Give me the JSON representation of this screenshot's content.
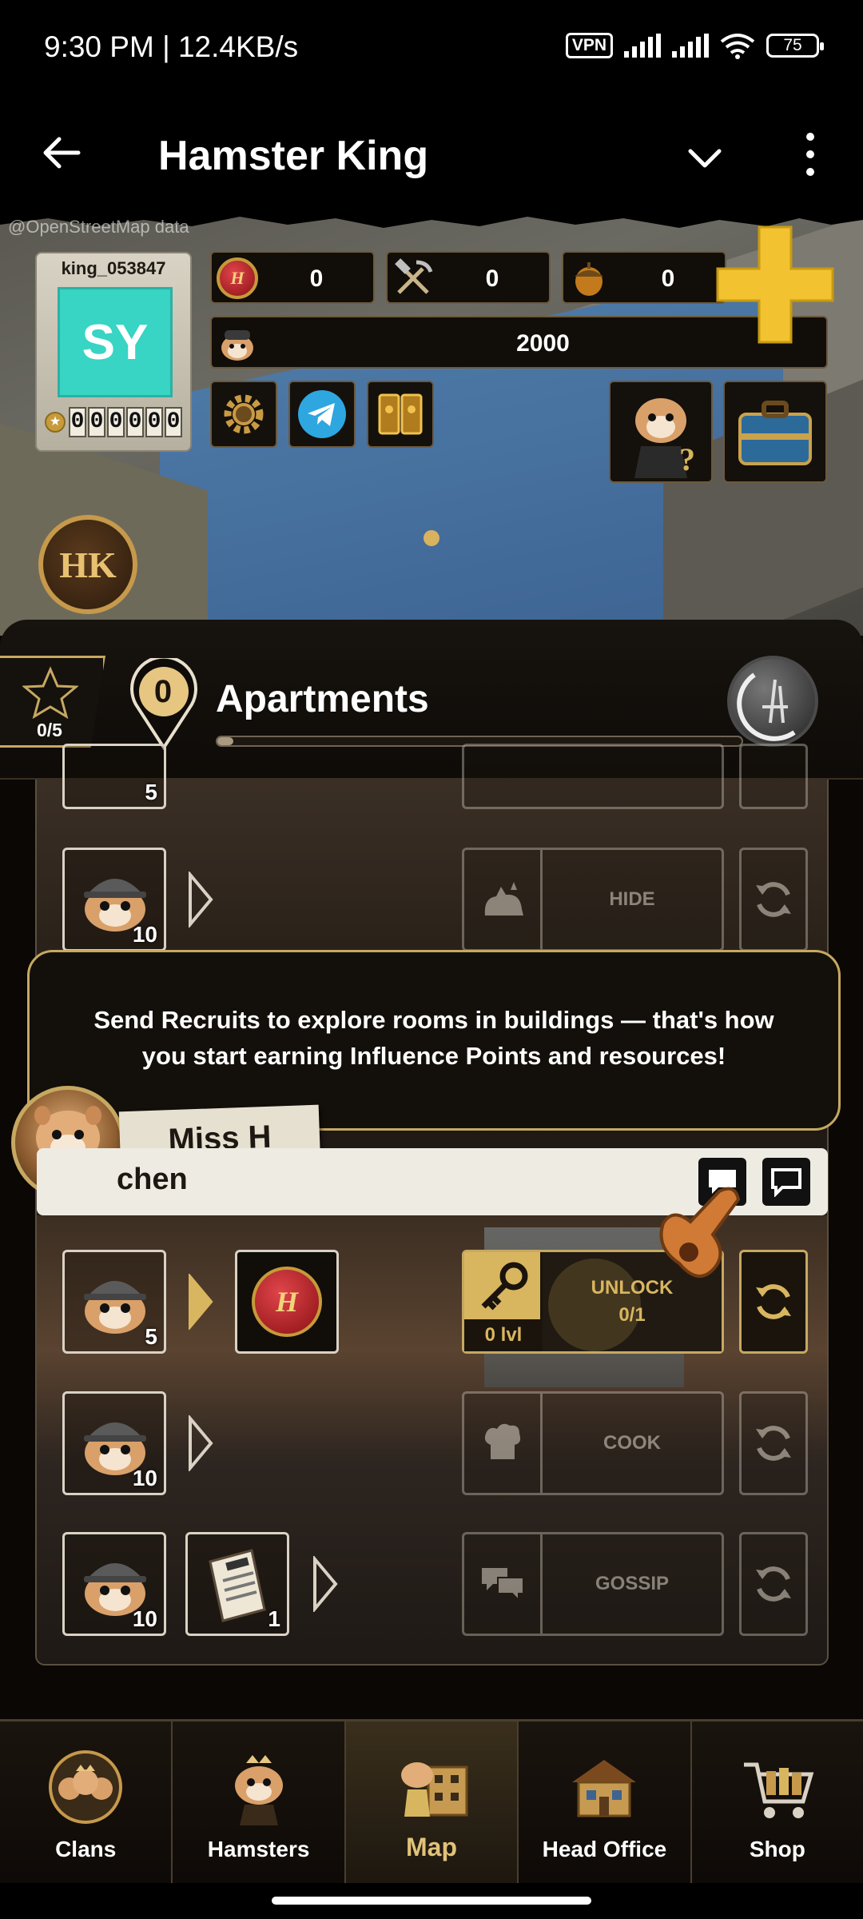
{
  "status": {
    "time": "9:30 PM | 12.4KB/s",
    "vpn": "VPN",
    "battery": "75"
  },
  "appbar": {
    "title": "Hamster King"
  },
  "map": {
    "attribution": "@OpenStreetMap data"
  },
  "profile": {
    "username": "king_053847",
    "initials": "SY",
    "id_digits": [
      "0",
      "0",
      "0",
      "0",
      "0",
      "0"
    ]
  },
  "resources": {
    "coins": "0",
    "tools": "0",
    "acorns": "0",
    "hamsters": "2000"
  },
  "building": {
    "stars": "0/5",
    "level": "0",
    "name": "Apartments",
    "progress": 0.0
  },
  "rooms_above": {
    "partial_count": "5",
    "hide_row": {
      "count": "10",
      "action": "HIDE"
    }
  },
  "tooltip": {
    "text": "Send Recruits to explore rooms in buildings — that's how you start earning Influence Points and resources!",
    "speaker": "Miss H"
  },
  "kitchen": {
    "title": "Kitchen",
    "title_visible": "chen",
    "rows": [
      {
        "count": "5",
        "action_line1": "UNLOCK",
        "action_line2": "0/1",
        "level": "0 lvl"
      },
      {
        "count": "10",
        "action": "COOK"
      },
      {
        "count": "10",
        "item_count": "1",
        "action": "GOSSIP"
      }
    ]
  },
  "nav": [
    {
      "label": "Clans",
      "icon": "clans-icon"
    },
    {
      "label": "Hamsters",
      "icon": "hamster-icon"
    },
    {
      "label": "Map",
      "icon": "map-icon",
      "active": true
    },
    {
      "label": "Head Office",
      "icon": "head-office-icon"
    },
    {
      "label": "Shop",
      "icon": "shop-cart-icon"
    }
  ],
  "colors": {
    "accent_gold": "#c6a861",
    "avatar_teal": "#38d4c4",
    "panel_dark": "#110d09",
    "plus_yellow": "#f2c230"
  }
}
